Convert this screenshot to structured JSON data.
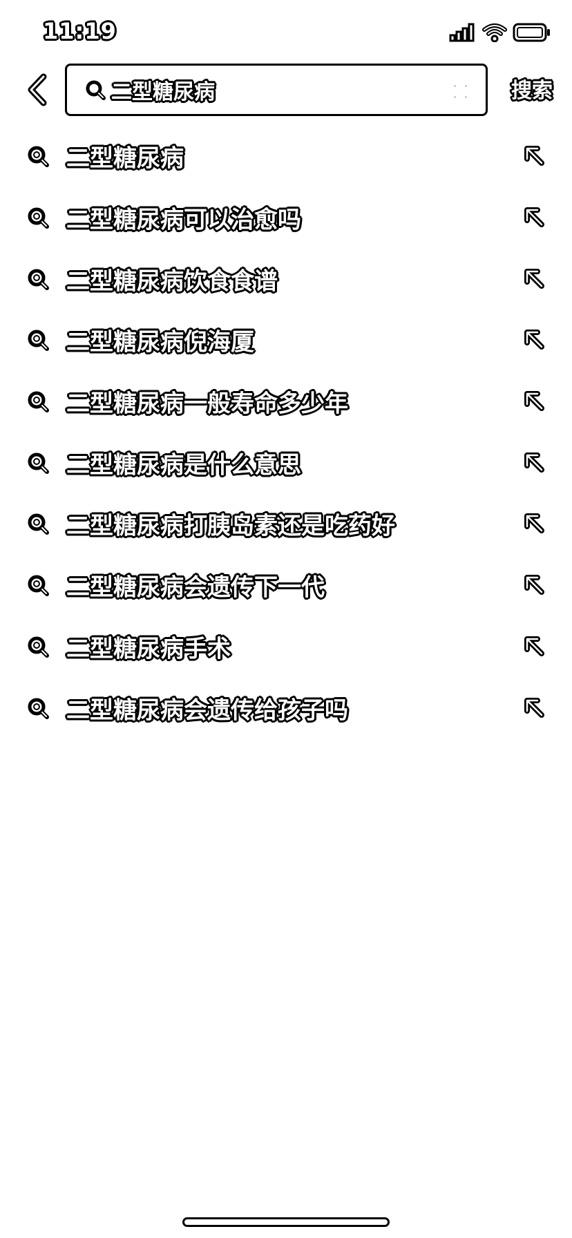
{
  "status_bar": {
    "time": "11:19",
    "icons": [
      "cellular-signal-icon",
      "wifi-icon",
      "battery-icon"
    ]
  },
  "header": {
    "back_icon": "chevron-left-icon",
    "search_icon": "search-icon",
    "query": "二型糖尿病",
    "submit_label": "搜索"
  },
  "suggestions": [
    {
      "text": "二型糖尿病"
    },
    {
      "text": "二型糖尿病可以治愈吗"
    },
    {
      "text": "二型糖尿病饮食食谱"
    },
    {
      "text": "二型糖尿病倪海厦"
    },
    {
      "text": "二型糖尿病一般寿命多少年"
    },
    {
      "text": "二型糖尿病是什么意思"
    },
    {
      "text": "二型糖尿病打胰岛素还是吃药好"
    },
    {
      "text": "二型糖尿病会遗传下一代"
    },
    {
      "text": "二型糖尿病手术"
    },
    {
      "text": "二型糖尿病会遗传给孩子吗"
    }
  ],
  "colors": {
    "background": "#ffffff",
    "text_fill": "#ffffff",
    "text_outline": "#000000"
  }
}
